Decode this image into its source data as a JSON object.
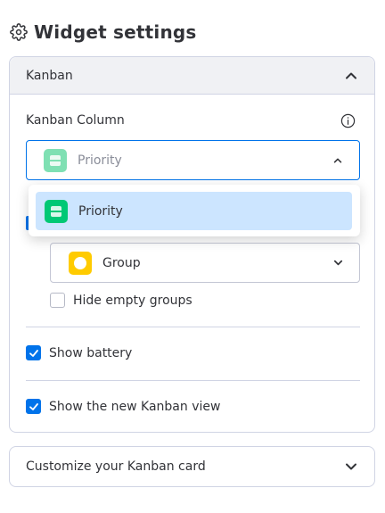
{
  "header": {
    "title": "Widget settings",
    "icon": "gear-icon"
  },
  "kanban_section": {
    "title": "Kanban",
    "expanded": true,
    "column_field": {
      "label": "Kanban Column",
      "info_icon": "info-icon",
      "selected_value": "Priority",
      "open": true,
      "options": [
        "Priority"
      ]
    },
    "group_field": {
      "selected_value": "Group"
    },
    "checkboxes": {
      "hide_empty_groups": {
        "label": "Hide empty groups",
        "checked": false
      },
      "show_battery": {
        "label": "Show battery",
        "checked": true
      },
      "show_new_view": {
        "label": "Show the new Kanban view",
        "checked": true
      }
    }
  },
  "customize_section": {
    "title": "Customize your Kanban card",
    "expanded": false
  },
  "colors": {
    "accent": "#0073ea",
    "priority_icon": "#00c875",
    "group_icon": "#ffcb00",
    "option_highlight": "#cce5ff"
  }
}
